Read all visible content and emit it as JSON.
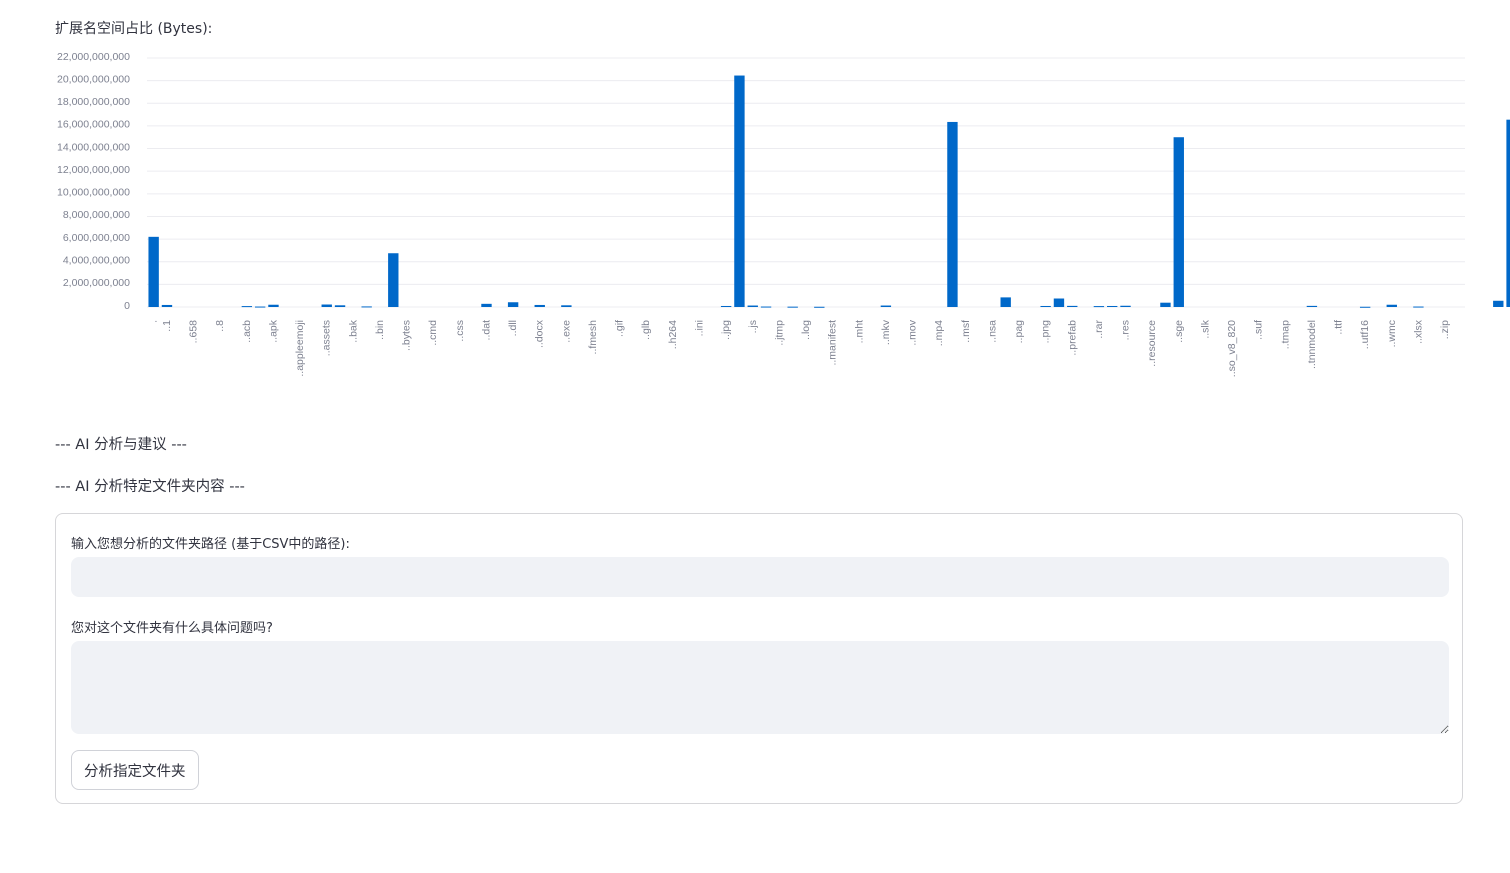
{
  "chart_section": {
    "caption": "扩展名空间占比 (Bytes):"
  },
  "chart_data": {
    "type": "bar",
    "title": "",
    "xlabel": "",
    "ylabel": "",
    "ylim": [
      0,
      22000000000
    ],
    "yticks": [
      0,
      2000000000,
      4000000000,
      6000000000,
      8000000000,
      10000000000,
      12000000000,
      14000000000,
      16000000000,
      18000000000,
      20000000000,
      22000000000
    ],
    "ytick_labels": [
      "0",
      "2,000,000,000",
      "4,000,000,000",
      "6,000,000,000",
      "8,000,000,000",
      "10,000,000,000",
      "12,000,000,000",
      "14,000,000,000",
      "16,000,000,000",
      "18,000,000,000",
      "20,000,000,000",
      "22,000,000,000"
    ],
    "grid": true,
    "bar_color": "#0068c9",
    "tick_label_color": "#7d8190",
    "categories": [
      ".",
      "..1",
      "",
      "..658",
      "",
      "..8",
      "",
      "..acb",
      "",
      "..apk",
      "",
      "..appleemoji",
      "",
      "..assets",
      "",
      "..bak",
      "",
      "..bin",
      "",
      "..bytes",
      "",
      "..cmd",
      "",
      "..css",
      "",
      "..dat",
      "",
      "..dll",
      "",
      "..docx",
      "",
      "..exe",
      "",
      "..fmesh",
      "",
      "..gif",
      "",
      "..glb",
      "",
      "..h264",
      "",
      "..ini",
      "",
      "..jpg",
      "",
      "..js",
      "",
      "..jtmp",
      "",
      "..log",
      "",
      "..manifest",
      "",
      "..mht",
      "",
      "..mkv",
      "",
      "..mov",
      "",
      "..mp4",
      "",
      "..msf",
      "",
      "..nsa",
      "",
      "..pag",
      "",
      "..png",
      "",
      "..prefab",
      "",
      "..rar",
      "",
      "..res",
      "",
      "..resource",
      "",
      "..sge",
      "",
      "..slk",
      "",
      "..so_v8_820",
      "",
      "..suf",
      "",
      "..tmap",
      "",
      "..tnnmodel",
      "",
      "..ttf",
      "",
      "..utf16",
      "",
      "..wmc",
      "",
      "..xlsx",
      "",
      "..zip",
      ""
    ],
    "values": [
      6200000000,
      180000000,
      0,
      0,
      0,
      0,
      0,
      80000000,
      40000000,
      200000000,
      0,
      0,
      0,
      220000000,
      150000000,
      0,
      50000000,
      0,
      4750000000,
      0,
      0,
      0,
      0,
      0,
      0,
      280000000,
      0,
      420000000,
      0,
      180000000,
      0,
      150000000,
      0,
      0,
      0,
      0,
      0,
      0,
      0,
      0,
      0,
      0,
      0,
      90000000,
      20450000000,
      130000000,
      40000000,
      0,
      30000000,
      0,
      20000000,
      0,
      0,
      0,
      0,
      130000000,
      0,
      0,
      0,
      0,
      16350000000,
      0,
      0,
      0,
      850000000,
      0,
      0,
      90000000,
      750000000,
      100000000,
      0,
      80000000,
      90000000,
      110000000,
      0,
      0,
      380000000,
      15000000000,
      0,
      0,
      0,
      0,
      0,
      0,
      0,
      0,
      0,
      100000000,
      0,
      0,
      0,
      20000000,
      0,
      200000000,
      0,
      40000000,
      0,
      0,
      0,
      0,
      0,
      550000000,
      16550000000
    ]
  },
  "analysis": {
    "heading_advice": "--- AI 分析与建议 ---",
    "heading_folder": "--- AI 分析特定文件夹内容 ---"
  },
  "form": {
    "path_label": "输入您想分析的文件夹路径 (基于CSV中的路径):",
    "path_value": "",
    "path_placeholder": "",
    "question_label": "您对这个文件夹有什么具体问题吗?",
    "question_value": "",
    "question_placeholder": "",
    "submit_label": "分析指定文件夹"
  }
}
